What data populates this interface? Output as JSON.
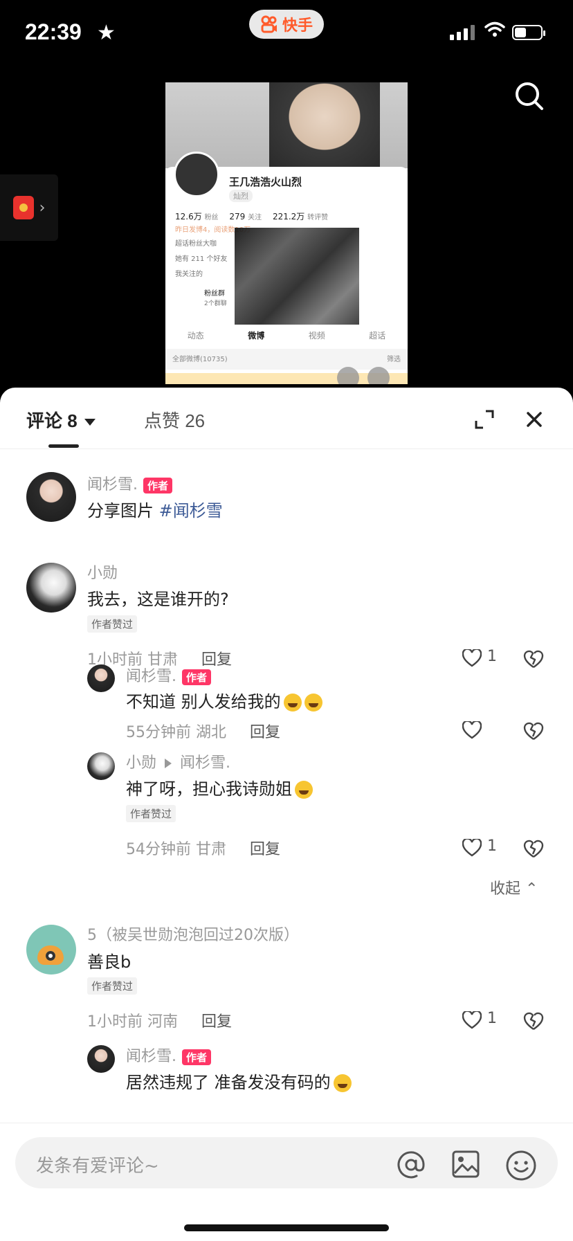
{
  "status": {
    "time": "22:39",
    "app_name": "快手"
  },
  "screenshot": {
    "name": "王几浩浩火山烈",
    "badge": "灿烈",
    "stats": [
      {
        "value": "12.6万",
        "label": "粉丝"
      },
      {
        "value": "279",
        "label": "关注"
      },
      {
        "value": "221.2万",
        "label": "转评赞"
      }
    ],
    "line1": "昨日发博4，阅读数10万",
    "line2": "超话粉丝大咖",
    "line3": "她有 211 个好友",
    "line4": "我关注的",
    "fans_group": "粉丝群",
    "fans_group_sub": "2个群聊",
    "tabs": [
      "动态",
      "微博",
      "视频",
      "超话"
    ],
    "footer": "全部微博(10735)",
    "filter": "筛选"
  },
  "tabs": {
    "comments": "评论 8",
    "likes": "点赞 26"
  },
  "author_tag": "作者",
  "liked_tag": "作者赞过",
  "reply_label": "回复",
  "comments": [
    {
      "user": "闻杉雪.",
      "text": "分享图片 ",
      "hashtag": "#闻杉雪"
    },
    {
      "user": "小勋",
      "text": "我去，这是谁开的?",
      "time": "1小时前",
      "location": "甘肃",
      "likes": "1",
      "replies": [
        {
          "user": "闻杉雪.",
          "text": "不知道 别人发给我的",
          "time": "55分钟前",
          "location": "湖北"
        },
        {
          "user": "小勋",
          "to": "闻杉雪.",
          "text": "神了呀，担心我诗勋姐",
          "time": "54分钟前",
          "location": "甘肃",
          "likes": "1"
        }
      ]
    },
    {
      "user": "5（被吴世勋泡泡回过20次版）",
      "text": "善良b",
      "time": "1小时前",
      "location": "河南",
      "likes": "1",
      "replies": [
        {
          "user": "闻杉雪.",
          "text": "居然违规了 准备发没有码的"
        }
      ]
    }
  ],
  "collapse_label": "收起",
  "input_placeholder": "发条有爱评论~",
  "colors": {
    "author_tag": "#fe3666",
    "hashtag": "#3c5a96",
    "brand": "#ff5a2a"
  }
}
